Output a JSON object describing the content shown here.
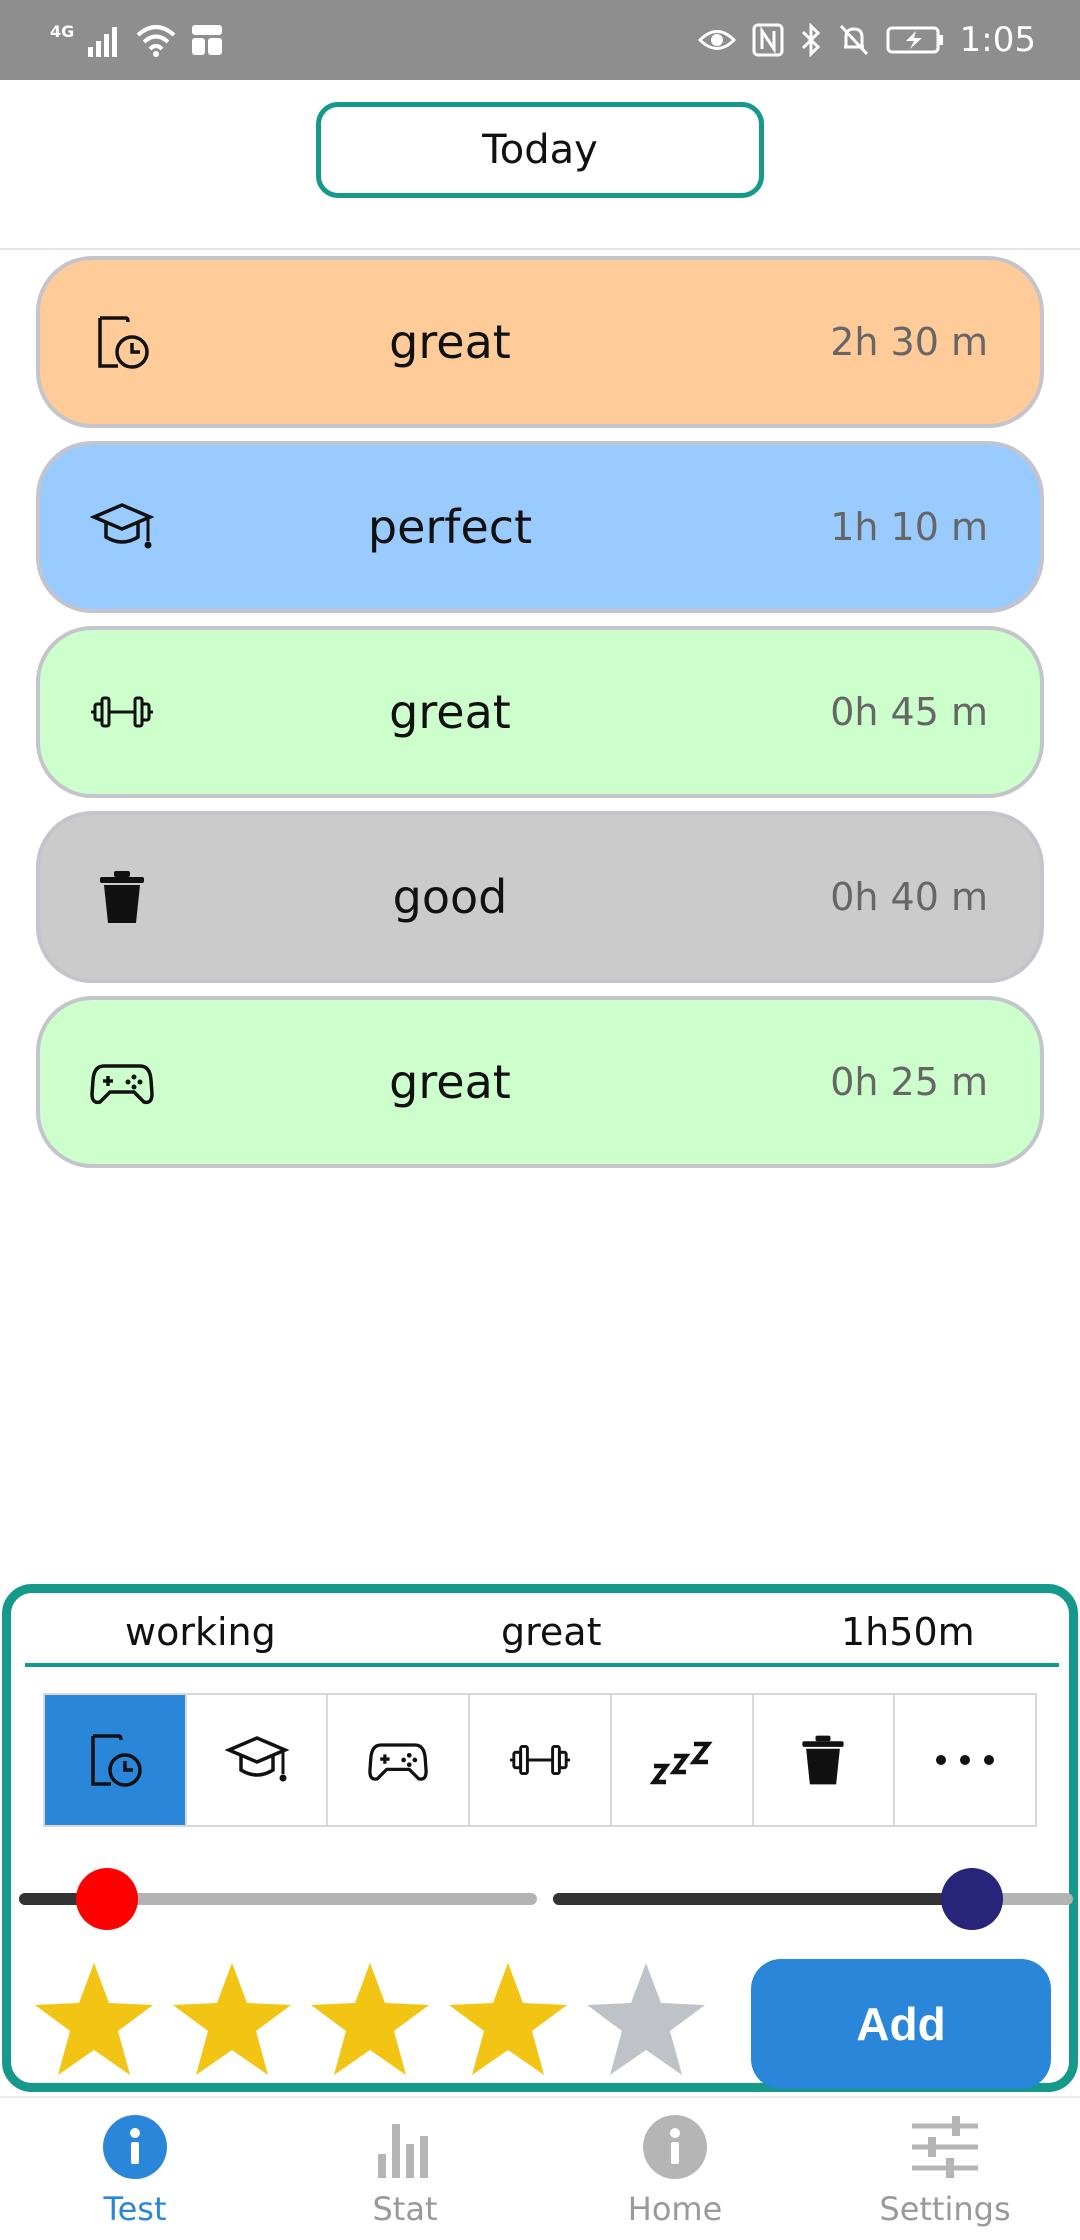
{
  "status_bar": {
    "network": "4G",
    "time": "1:05"
  },
  "header": {
    "today_label": "Today"
  },
  "entries": [
    {
      "icon": "clock-document-icon",
      "label": "great",
      "time": "2h 30 m",
      "color": "#ffcb99"
    },
    {
      "icon": "graduation-cap-icon",
      "label": "perfect",
      "time": "1h 10 m",
      "color": "#99cbff"
    },
    {
      "icon": "dumbbell-icon",
      "label": "great",
      "time": "0h 45 m",
      "color": "#ccffcc"
    },
    {
      "icon": "trash-icon",
      "label": "good",
      "time": "0h 40 m",
      "color": "#cbcbcb"
    },
    {
      "icon": "gamepad-icon",
      "label": "great",
      "time": "0h 25 m",
      "color": "#ccffcc"
    }
  ],
  "panel": {
    "summary": {
      "activity": "working",
      "rating": "great",
      "duration": "1h50m"
    },
    "categories": [
      "clock-document-icon",
      "graduation-cap-icon",
      "gamepad-icon",
      "dumbbell-icon",
      "sleep-icon",
      "trash-icon",
      "more-icon"
    ],
    "selected_category": 0,
    "rating_stars": 4,
    "max_stars": 5,
    "add_label": "Add",
    "accent": "#14998a",
    "selected_color": "#2a86d9"
  },
  "nav": [
    {
      "label": "Test",
      "icon": "info-icon",
      "active": true
    },
    {
      "label": "Stat",
      "icon": "bar-chart-icon",
      "active": false
    },
    {
      "label": "Home",
      "icon": "info-icon",
      "active": false
    },
    {
      "label": "Settings",
      "icon": "sliders-icon",
      "active": false
    }
  ]
}
